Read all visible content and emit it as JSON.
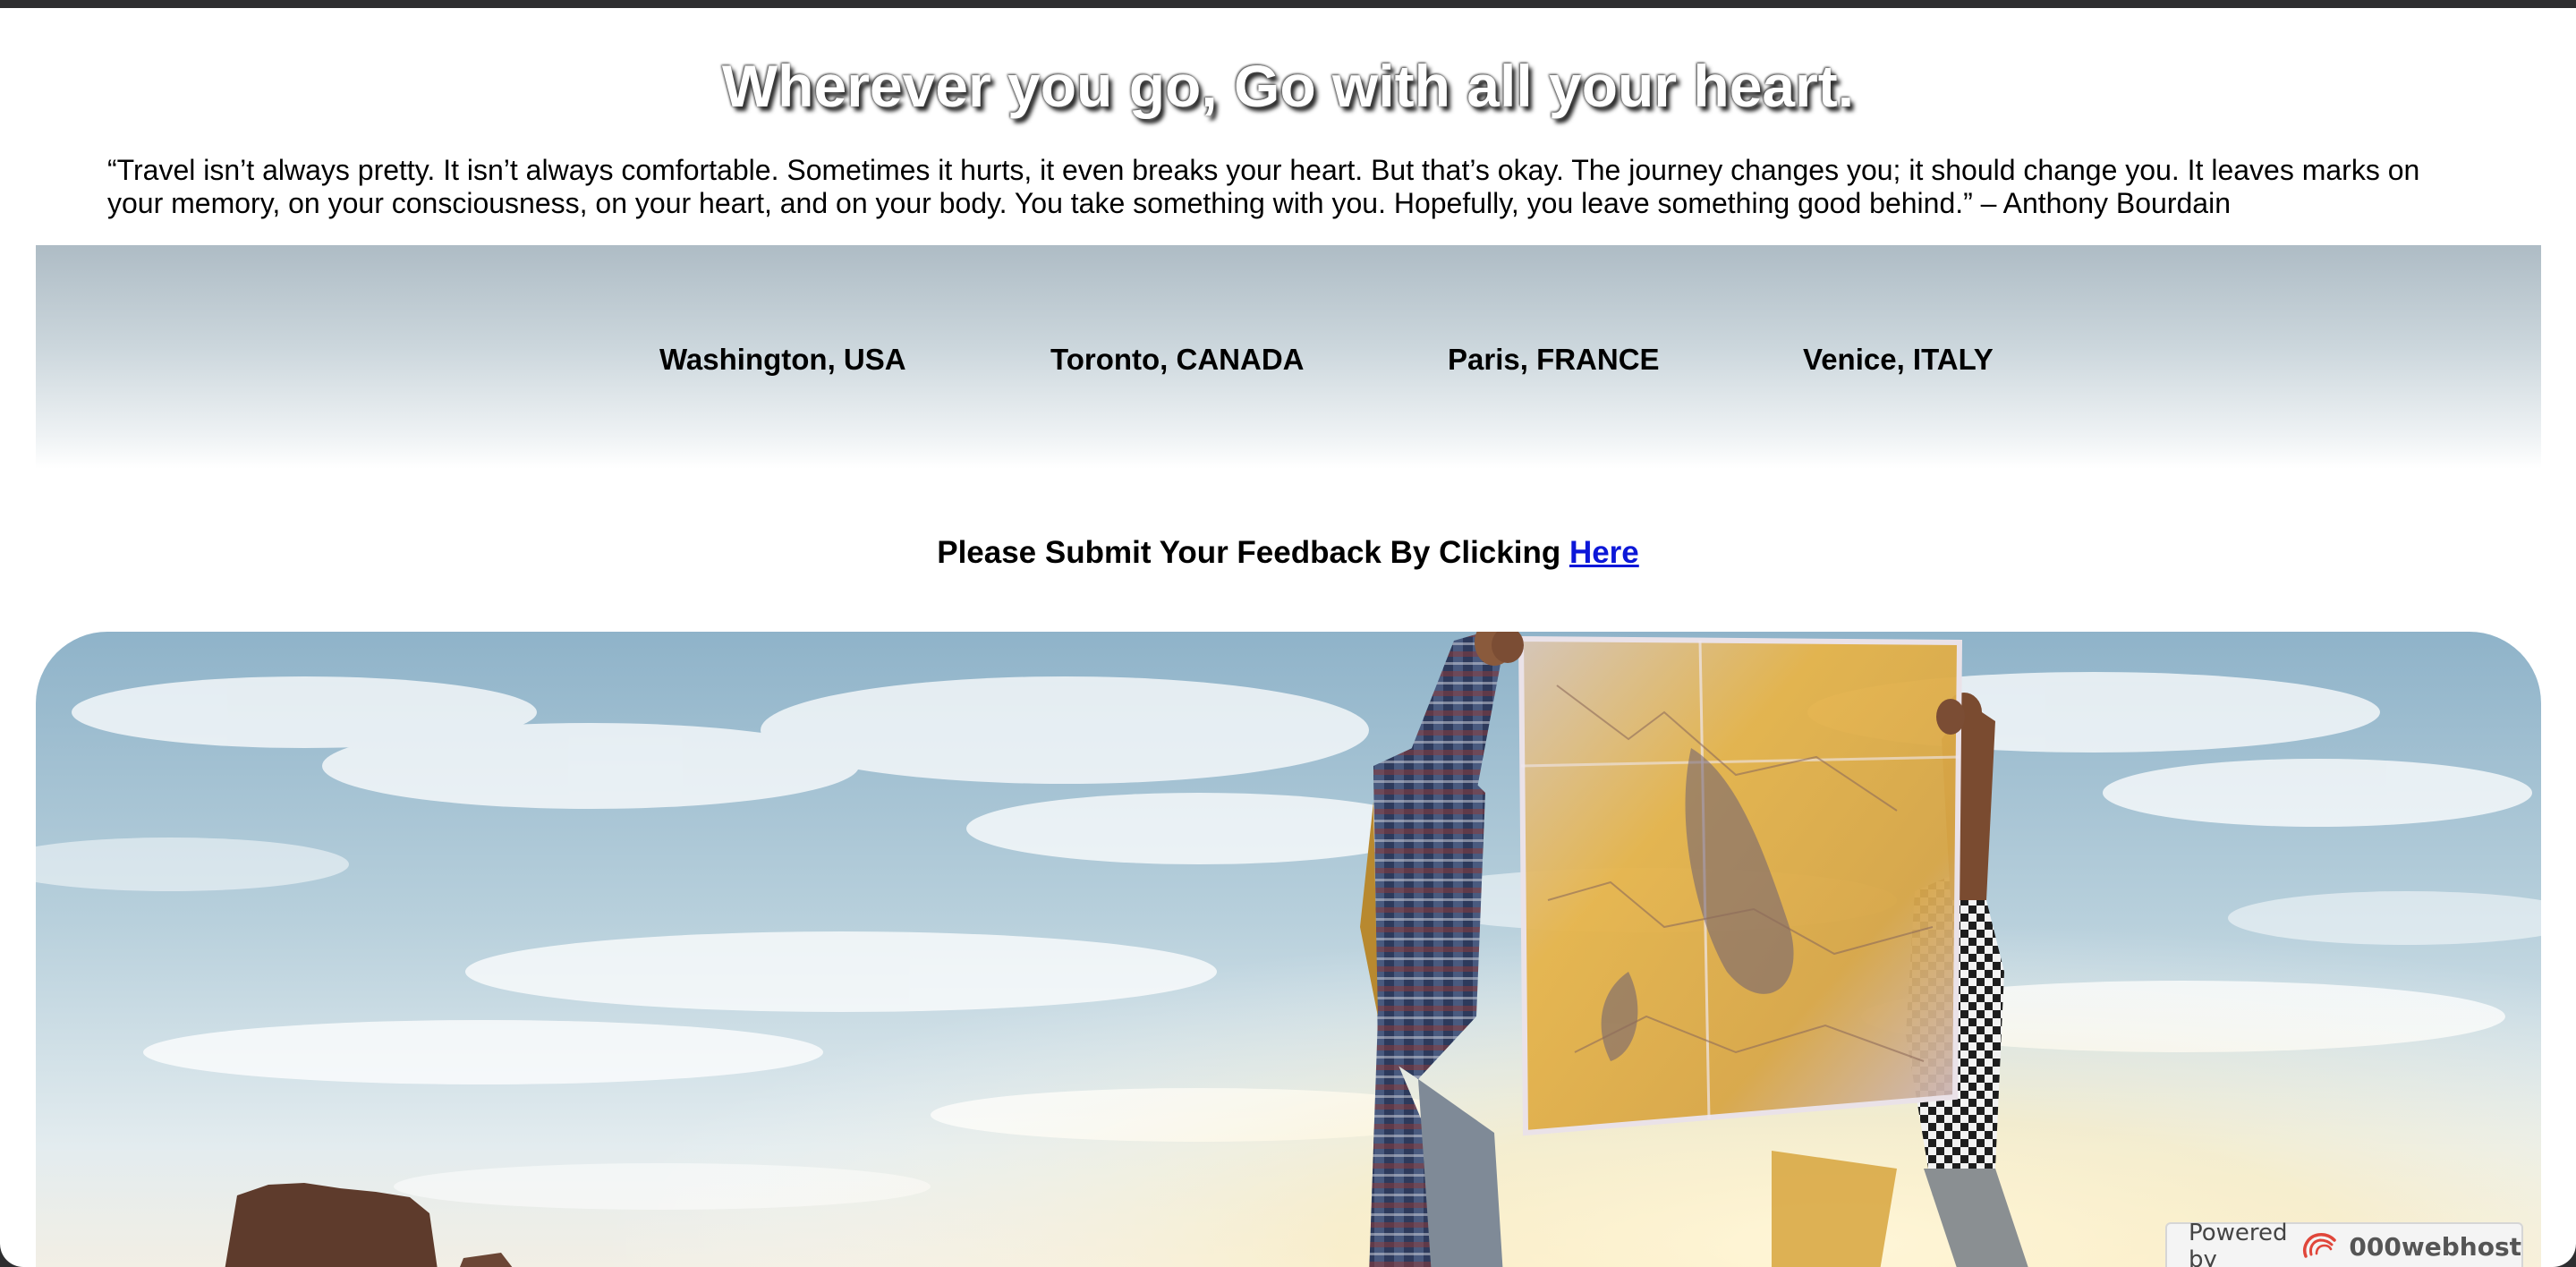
{
  "headline": "Wherever you go, Go with all your heart.",
  "quote": "“Travel isn’t always pretty. It isn’t always comfortable. Sometimes it hurts, it even breaks your heart. But that’s okay. The journey changes you; it should change you. It leaves marks on your memory, on your consciousness, on your heart, and on your body. You take something with you. Hopefully, you leave something good behind.” – Anthony Bourdain",
  "nav": {
    "links": [
      "Washington, USA",
      "Toronto, CANADA",
      "Paris, FRANCE",
      "Venice, ITALY"
    ]
  },
  "feedback": {
    "text": "Please Submit Your Feedback By Clicking ",
    "link_label": "Here"
  },
  "footer_badge": {
    "powered_by": "Powered by",
    "brand": "000webhost",
    "logo_icon": "000webhost-swirl-logo"
  },
  "colors": {
    "link": "#0c17d8",
    "browser_frame": "#2e2e30",
    "nav_gradient_top": "#aebcc5"
  }
}
